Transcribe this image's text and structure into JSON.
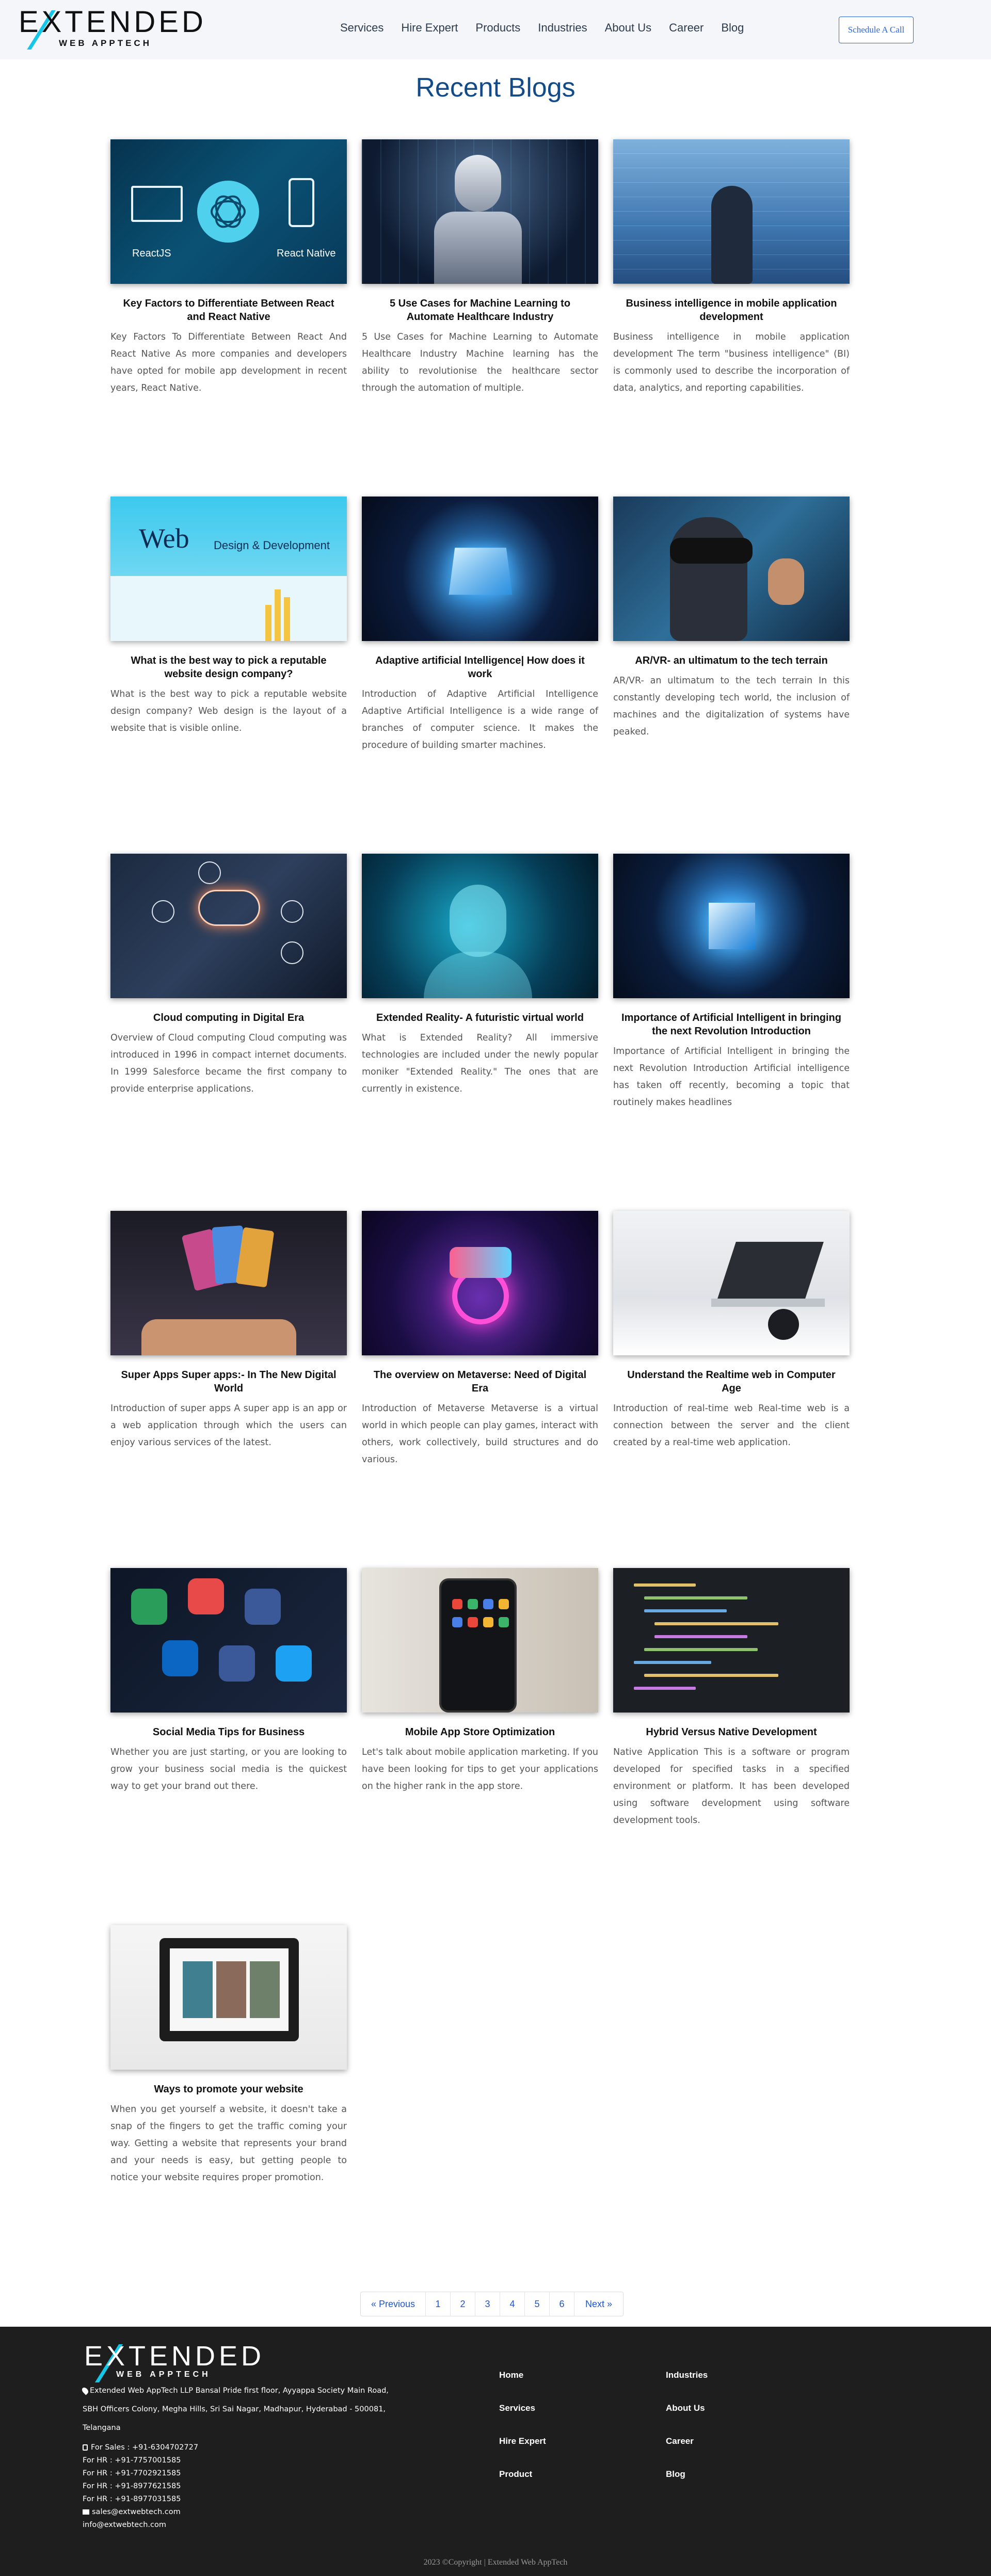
{
  "header": {
    "logo_word": "EXTENDED",
    "logo_sub": "WEB APPTECH",
    "nav": [
      "Services",
      "Hire Expert",
      "Products",
      "Industries",
      "About Us",
      "Career",
      "Blog"
    ],
    "cta": "Schedule A Call"
  },
  "page_title": "Recent Blogs",
  "posts": [
    {
      "title": "Key Factors to Differentiate Between React and React Native",
      "excerpt": "Key Factors To Differentiate Between React And React Native As more companies and developers have opted for mobile app development in recent years, React Native.",
      "image": "react-vs-react-native",
      "image_labels": [
        "ReactJS",
        "React Native"
      ]
    },
    {
      "title": "5 Use Cases for Machine Learning to Automate Healthcare Industry",
      "excerpt": "5 Use Cases for Machine Learning to Automate Healthcare Industry Machine learning has the ability to revolutionise the healthcare sector through the automation of multiple.",
      "image": "robot-ai"
    },
    {
      "title": "Business intelligence in mobile application development",
      "excerpt": "Business intelligence in mobile application development The term \"business intelligence\" (BI) is commonly used to describe the incorporation of data, analytics, and reporting capabilities.",
      "image": "business-intelligence"
    },
    {
      "title": "What is the best way to pick a reputable website design company?",
      "excerpt": "What is the best way to pick a reputable website design company? Web design is the layout of a website that is visible online.",
      "image": "web-design",
      "image_labels": [
        "Web",
        "Design & Development"
      ]
    },
    {
      "title": "Adaptive artificial Intelligence| How does it work",
      "excerpt": "Introduction of Adaptive Artificial Intelligence Adaptive Artificial Intelligence is a wide range of branches of computer science. It makes the procedure of building smarter machines.",
      "image": "ai-chip"
    },
    {
      "title": "AR/VR- an ultimatum to the tech terrain",
      "excerpt": "AR/VR- an ultimatum to the tech terrain In this constantly developing tech world, the inclusion of machines and the digitalization of systems have peaked.",
      "image": "vr-headset"
    },
    {
      "title": "Cloud computing in Digital Era",
      "excerpt": "Overview of Cloud computing Cloud computing was introduced in 1996 in compact internet documents. In 1999 Salesforce became the first company to provide enterprise applications.",
      "image": "cloud-computing"
    },
    {
      "title": "Extended Reality- A futuristic virtual world",
      "excerpt": "What is Extended Reality? All immersive technologies are included under the newly popular moniker \"Extended Reality.\" The ones that are currently in existence.",
      "image": "extended-reality"
    },
    {
      "title": "Importance of Artificial Intelligent in bringing the next Revolution Introduction",
      "excerpt": "Importance of Artificial Intelligent in bringing the next Revolution Introduction Artificial intelligence has taken off recently, becoming a topic that routinely makes headlines",
      "image": "ai-processor"
    },
    {
      "title": "Super Apps Super apps:- In The New Digital World",
      "excerpt": "Introduction of super apps A super app is an app or a web application through which the users can enjoy various services of the latest.",
      "image": "super-apps"
    },
    {
      "title": "The overview on Metaverse: Need of Digital Era",
      "excerpt": "Introduction of Metaverse Metaverse is a virtual world in which people can play games, interact with others, work collectively, build structures and do various.",
      "image": "metaverse"
    },
    {
      "title": "Understand the Realtime web in Computer Age",
      "excerpt": "Introduction of real-time web Real-time web is a connection between the server and the client created by a real-time web application.",
      "image": "laptop-desk"
    },
    {
      "title": "Social Media Tips for Business",
      "excerpt": "Whether you are just starting, or you are looking to grow your business social media is the quickest way to get your brand out there.",
      "image": "social-media"
    },
    {
      "title": "Mobile App Store Optimization",
      "excerpt": "Let's talk about mobile application marketing. If you have been looking for tips to get your applications on the higher rank in the app store.",
      "image": "mobile-app"
    },
    {
      "title": "Hybrid Versus Native Development",
      "excerpt": "Native Application This is a software or program developed for specified tasks in a specified environment or platform. It has been developed using software development using software development tools.",
      "image": "code-screen"
    },
    {
      "title": "Ways to promote your website",
      "excerpt": "When you get yourself a website, it doesn't take a snap of the fingers to get the traffic coming your way. Getting a website that represents your brand and your needs is easy, but getting people to notice your website requires proper promotion.",
      "image": "website-monitor"
    }
  ],
  "pagination": {
    "prev": "« Previous",
    "pages": [
      "1",
      "2",
      "3",
      "4",
      "5",
      "6"
    ],
    "next": "Next »"
  },
  "footer": {
    "logo_word": "EXTENDED",
    "logo_sub": "WEB APPTECH",
    "address_line1": "Extended Web AppTech LLP Bansal Pride first floor, Ayyappa Society Main Road,",
    "address_line2": "SBH Officers Colony, Megha Hills, Sri Sai Nagar, Madhapur, Hyderabad - 500081,",
    "address_line3": "Telangana",
    "contacts": [
      "For Sales : +91-6304702727",
      "For HR : +91-7757001585",
      "For HR : +91-7702921585",
      "For HR : +91-8977621585",
      "For HR : +91-8977031585"
    ],
    "emails": [
      "sales@extwebtech.com",
      "info@extwebtech.com"
    ],
    "links_col1": [
      "Home",
      "Services",
      "Hire Expert",
      "Product"
    ],
    "links_col2": [
      "Industries",
      "About Us",
      "Career",
      "Blog"
    ],
    "copyright": "2023 ©Copyright | Extended Web AppTech"
  },
  "colors": {
    "title_blue": "#134a88",
    "link_blue": "#1f55c9",
    "accent_cyan": "#16c6e8",
    "footer_bg": "#1e1e1e"
  }
}
